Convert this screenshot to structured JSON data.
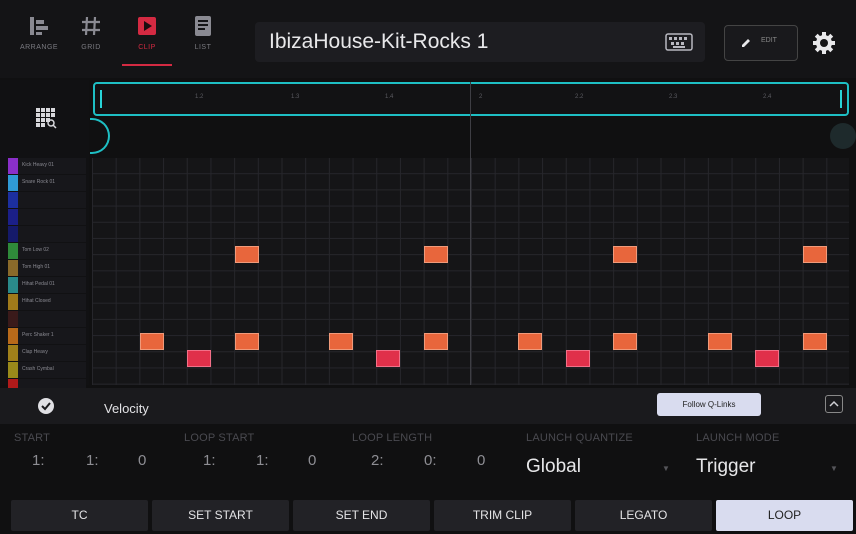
{
  "top_bar": {
    "modes": [
      {
        "label": "ARRANGE",
        "icon": "arrange-icon"
      },
      {
        "label": "GRID",
        "icon": "grid-icon"
      },
      {
        "label": "CLIP",
        "icon": "clip-icon",
        "active": true
      },
      {
        "label": "LIST",
        "icon": "list-icon"
      }
    ],
    "title": "IbizaHouse-Kit-Rocks 1",
    "edit_label": "EDIT"
  },
  "timeline": {
    "ticks": [
      "1.2",
      "1.3",
      "1.4",
      "2",
      "2.2",
      "2.3",
      "2.4"
    ]
  },
  "pads": [
    {
      "name": "Kick Heavy 01",
      "color": "#8a2fc9"
    },
    {
      "name": "Snare Rock 01",
      "color": "#2f9ad6"
    },
    {
      "name": "",
      "color": "#1c2fa0"
    },
    {
      "name": "",
      "color": "#1b1f88"
    },
    {
      "name": "",
      "color": "#151a6a"
    },
    {
      "name": "Tom Low 02",
      "color": "#2f8a3a"
    },
    {
      "name": "Tom High 01",
      "color": "#8a6a2a"
    },
    {
      "name": "Hihat Pedal 01",
      "color": "#2a8a8a"
    },
    {
      "name": "Hihat Closed",
      "color": "#a07a1a"
    },
    {
      "name": "",
      "color": "#3a1a1a"
    },
    {
      "name": "Perc Shaker 1",
      "color": "#b86a1a"
    },
    {
      "name": "Clap Heavy",
      "color": "#a0801a"
    },
    {
      "name": "Crash Cymbal",
      "color": "#9a8a1a"
    },
    {
      "name": "",
      "color": "#b01a1a"
    }
  ],
  "notes": {
    "orange": "#e8663c",
    "red": "#e0304a"
  },
  "velocity_bar": {
    "label": "Velocity",
    "qlinks_label": "Follow Q-Links"
  },
  "params": {
    "start": {
      "label": "START",
      "bars": "1:",
      "beats": "1:",
      "ticks": "0"
    },
    "loop_start": {
      "label": "LOOP START",
      "bars": "1:",
      "beats": "1:",
      "ticks": "0"
    },
    "loop_length": {
      "label": "LOOP LENGTH",
      "bars": "2:",
      "beats": "0:",
      "ticks": "0"
    },
    "launch_quantize": {
      "label": "LAUNCH QUANTIZE",
      "value": "Global"
    },
    "launch_mode": {
      "label": "LAUNCH MODE",
      "value": "Trigger"
    }
  },
  "bottom_buttons": [
    {
      "label": "TC"
    },
    {
      "label": "SET START"
    },
    {
      "label": "SET END"
    },
    {
      "label": "TRIM CLIP"
    },
    {
      "label": "LEGATO"
    },
    {
      "label": "LOOP",
      "active": true
    }
  ]
}
